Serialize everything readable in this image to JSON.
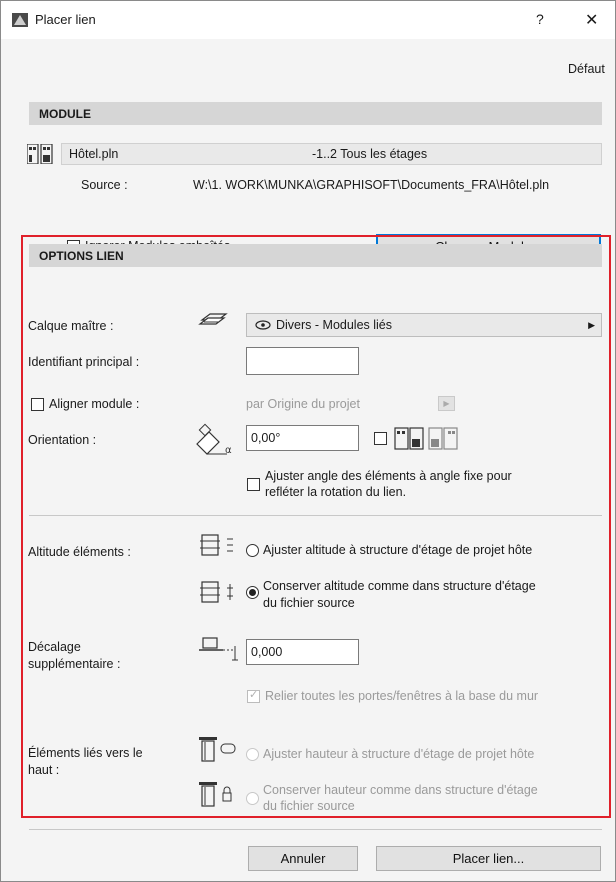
{
  "window": {
    "title": "Placer lien",
    "help": "?",
    "close": "✕"
  },
  "defaults_link": "Défaut",
  "module": {
    "header": "MODULE",
    "file_name": "Hôtel.pln",
    "stories": "-1..2 Tous les étages",
    "source_label": "Source :",
    "source_path": "W:\\1. WORK\\MUNKA\\GRAPHISOFT\\Documents_FRA\\Hôtel.pln",
    "ignore_nested_label": "Ignorer Modules emboîtés",
    "ignore_nested_checked": false,
    "change_button": "Changer Module..."
  },
  "options": {
    "header": "OPTIONS LIEN",
    "master_layer_label": "Calque maître :",
    "master_layer_value": "Divers - Modules liés",
    "main_id_label": "Identifiant principal :",
    "main_id_value": "",
    "align_label": "Aligner module :",
    "align_checked": false,
    "align_value": "par Origine du projet",
    "orientation_label": "Orientation :",
    "orientation_value": "0,00°",
    "mirror_checked": false,
    "adjust_angle_label": "Ajuster angle des éléments à angle fixe pour",
    "adjust_angle_label2": "refléter la rotation du lien.",
    "adjust_angle_checked": false,
    "elev_label": "Altitude éléments :",
    "elev_opt1": "Ajuster altitude à structure d'étage de projet hôte",
    "elev_opt2": "Conserver altitude comme dans structure d'étage",
    "elev_opt2b": "du fichier source",
    "elev_selected": 2,
    "offset_label": "Décalage",
    "offset_label2": "supplémentaire :",
    "offset_value": "0,000",
    "connect_label": "Relier toutes les portes/fenêtres à la base du mur",
    "connect_checked": true,
    "top_linked_label": "Éléments liés vers le",
    "top_linked_label2": "haut :",
    "top_opt1": "Ajuster hauteur à structure d'étage de projet hôte",
    "top_opt2": "Conserver hauteur comme dans structure d'étage",
    "top_opt2b": "du fichier source"
  },
  "footer": {
    "cancel": "Annuler",
    "place": "Placer lien..."
  },
  "colors": {
    "highlight_frame": "#e0202a",
    "accent_border": "#0078d7"
  }
}
